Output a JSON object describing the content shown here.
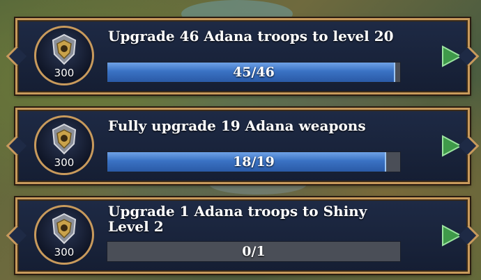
{
  "quests": [
    {
      "title": "Upgrade 46 Adana troops to level 20",
      "reward": "300",
      "progress_text": "45/46",
      "progress_fraction": 0.978
    },
    {
      "title": "Fully upgrade 19 Adana weapons",
      "reward": "300",
      "progress_text": "18/19",
      "progress_fraction": 0.947
    },
    {
      "title": "Upgrade 1 Adana troops to Shiny Level 2",
      "reward": "300",
      "progress_text": "0/1",
      "progress_fraction": 0
    }
  ],
  "colors": {
    "frame_gold": "#c89a5c",
    "panel_navy": "#1e2a45",
    "bar_blue": "#3a72c4",
    "arrow_green": "#3f9a4a"
  },
  "icons": {
    "badge": "warrior-helmet-emblem-icon",
    "go": "play-arrow-icon"
  }
}
